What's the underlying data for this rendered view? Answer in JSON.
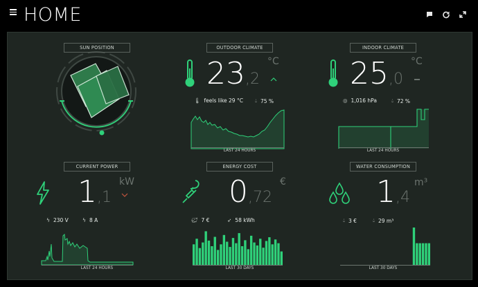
{
  "app": {
    "title": "HOME"
  },
  "top_icons": [
    "chat-icon",
    "refresh-icon",
    "fullscreen-icon"
  ],
  "colors": {
    "accent": "#2fd17a",
    "panel_bg": "#1f2622",
    "bg": "#000000",
    "muted": "#6b736e",
    "warning": "#c4563f"
  },
  "cards": {
    "sun": {
      "title": "SUN POSITION"
    },
    "outdoor": {
      "title": "OUTDOOR CLIMATE",
      "int": "23",
      "dec": ",2",
      "unit": "°C",
      "feels": "feels like 29 °C",
      "humidity": "75 %",
      "chart_label": "LAST 24 HOURS"
    },
    "indoor": {
      "title": "INDOOR CLIMATE",
      "int": "25",
      "dec": ",0",
      "unit": "°C",
      "pressure": "1,016 hPa",
      "humidity": "72 %",
      "chart_label": "LAST 24 HOURS"
    },
    "power": {
      "title": "CURRENT POWER",
      "int": "1",
      "dec": ",1",
      "unit": "kW",
      "voltage": "230 V",
      "current": "8 A",
      "chart_label": "LAST 24 HOURS"
    },
    "energy": {
      "title": "ENERGY COST",
      "int": "0",
      "dec": ",72",
      "unit": "€",
      "cost": "7 €",
      "kwh": "58 kWh",
      "chart_label": "LAST 30 DAYS",
      "bars": [
        0.55,
        0.7,
        0.45,
        0.6,
        0.9,
        0.65,
        0.5,
        0.75,
        0.4,
        0.55,
        0.8,
        0.62,
        0.48,
        0.72,
        0.58,
        0.85,
        0.5,
        0.66,
        0.42,
        0.78,
        0.6,
        0.52,
        0.7,
        0.46,
        0.64,
        0.74,
        0.55,
        0.68,
        0.58,
        0.36
      ]
    },
    "water": {
      "title": "WATER CONSUMPTION",
      "int": "1",
      "dec": ",4",
      "unit": "m³",
      "cost": "3 €",
      "volume": "29 m³",
      "chart_label": "LAST 30 DAYS",
      "bars": [
        0,
        0,
        0,
        0,
        0,
        0,
        0,
        0,
        0,
        0,
        0,
        0,
        0,
        0,
        0,
        0,
        0,
        0,
        0,
        0,
        0,
        0,
        0,
        0,
        1.0,
        0.58,
        0.58,
        0.58,
        0.58,
        0.58
      ]
    }
  }
}
